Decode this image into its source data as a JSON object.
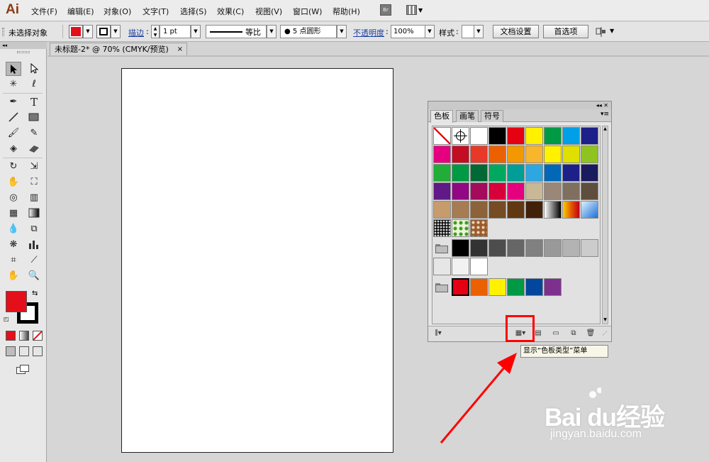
{
  "app": {
    "logo": "Ai"
  },
  "menubar": {
    "items": [
      "文件(F)",
      "编辑(E)",
      "对象(O)",
      "文字(T)",
      "选择(S)",
      "效果(C)",
      "视图(V)",
      "窗口(W)",
      "帮助(H)"
    ],
    "bridge_label": "Br"
  },
  "control_bar": {
    "selection_status": "未选择对象",
    "fill_color": "#e3101b",
    "stroke_label": "描边",
    "stroke_weight": "1 pt",
    "stroke_profile": "等比",
    "brush": "● 5 点圆形",
    "opacity_label": "不透明度",
    "opacity_value": "100%",
    "style_label": "样式",
    "doc_setup_button": "文档设置",
    "preferences_button": "首选项"
  },
  "document": {
    "tab_title": "未标题-2* @ 70% (CMYK/预览)",
    "close_glyph": "×"
  },
  "toolbox": {
    "fill_color": "#e3101b",
    "stroke_color": "#000000"
  },
  "swatches_panel": {
    "tabs": [
      "色板",
      "画笔",
      "符号"
    ],
    "active_tab": "色板",
    "rows": [
      {
        "type": "special",
        "colors": [
          "none",
          "registration",
          "#ffffff",
          "#000000",
          "#e50012",
          "#fff100",
          "#009944",
          "#00a0e9",
          "#1d2088"
        ]
      },
      {
        "type": "colors",
        "colors": [
          "#e4007f",
          "#c30d23",
          "#e83828",
          "#eb6100",
          "#f39800",
          "#f8b62d",
          "#fff100",
          "#dfdf00",
          "#8fc31f"
        ]
      },
      {
        "type": "colors",
        "colors": [
          "#22ac38",
          "#009944",
          "#006934",
          "#00a95f",
          "#009e96",
          "#2ea7e0",
          "#0068b7",
          "#1d2088",
          "#1a1a5e"
        ]
      },
      {
        "type": "colors",
        "colors": [
          "#601986",
          "#920783",
          "#a40b5d",
          "#d7003a",
          "#e4007f",
          "#c9b896",
          "#9b8778",
          "#7f6f5e",
          "#5f4e3e"
        ]
      },
      {
        "type": "colors",
        "colors": [
          "#c69c6d",
          "#a67c52",
          "#8c6239",
          "#754c24",
          "#603913",
          "#42210b",
          "gradient-bw",
          "gradient-orange",
          "gradient-blue"
        ]
      },
      {
        "type": "patterns",
        "colors": [
          "pattern-dots",
          "pattern-leaves",
          "pattern-swirl"
        ]
      },
      {
        "type": "group",
        "colors": [
          "#000000",
          "#333333",
          "#4d4d4d",
          "#666666",
          "#808080",
          "#999999",
          "#b3b3b3",
          "#cccccc"
        ]
      },
      {
        "type": "colors",
        "colors": [
          "#e6e6e6",
          "#f2f2f2",
          "#ffffff"
        ]
      },
      {
        "type": "group",
        "colors": [
          "#e50012",
          "#eb6100",
          "#fff100",
          "#009944",
          "#00479d",
          "#7d308e"
        ]
      }
    ],
    "tooltip": "显示“色板类型”菜单"
  },
  "annotation": {
    "highlight_color": "#ff0000"
  },
  "watermark": {
    "brand": "Bai du经验",
    "url": "jingyan.baidu.com"
  }
}
